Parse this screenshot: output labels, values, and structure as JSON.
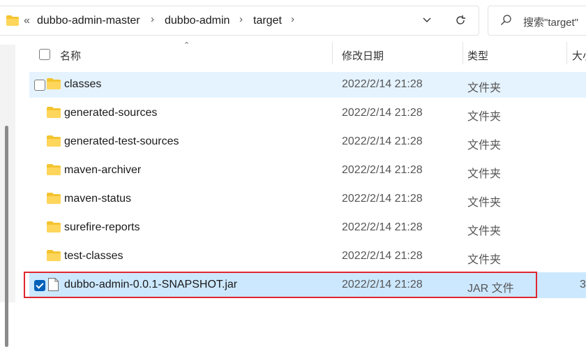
{
  "address_bar": {
    "overflow": "«",
    "crumbs": [
      "dubbo-admin-master",
      "dubbo-admin",
      "target"
    ]
  },
  "search": {
    "placeholder": "搜索\"target\""
  },
  "columns": {
    "name": "名称",
    "date": "修改日期",
    "type": "类型",
    "size": "大小"
  },
  "files": [
    {
      "name": "classes",
      "date": "2022/2/14 21:28",
      "type": "文件夹",
      "size": "",
      "kind": "folder"
    },
    {
      "name": "generated-sources",
      "date": "2022/2/14 21:28",
      "type": "文件夹",
      "size": "",
      "kind": "folder"
    },
    {
      "name": "generated-test-sources",
      "date": "2022/2/14 21:28",
      "type": "文件夹",
      "size": "",
      "kind": "folder"
    },
    {
      "name": "maven-archiver",
      "date": "2022/2/14 21:28",
      "type": "文件夹",
      "size": "",
      "kind": "folder"
    },
    {
      "name": "maven-status",
      "date": "2022/2/14 21:28",
      "type": "文件夹",
      "size": "",
      "kind": "folder"
    },
    {
      "name": "surefire-reports",
      "date": "2022/2/14 21:28",
      "type": "文件夹",
      "size": "",
      "kind": "folder"
    },
    {
      "name": "test-classes",
      "date": "2022/2/14 21:28",
      "type": "文件夹",
      "size": "",
      "kind": "folder"
    },
    {
      "name": "dubbo-admin-0.0.1-SNAPSHOT.jar",
      "date": "2022/2/14 21:28",
      "type": "JAR 文件",
      "size": "3",
      "kind": "file",
      "checked": true
    }
  ],
  "colors": {
    "selected_row": "#cce8ff",
    "hover_row": "#e5f3ff",
    "highlight_box": "#e0272d",
    "folder": "#f4c430"
  }
}
